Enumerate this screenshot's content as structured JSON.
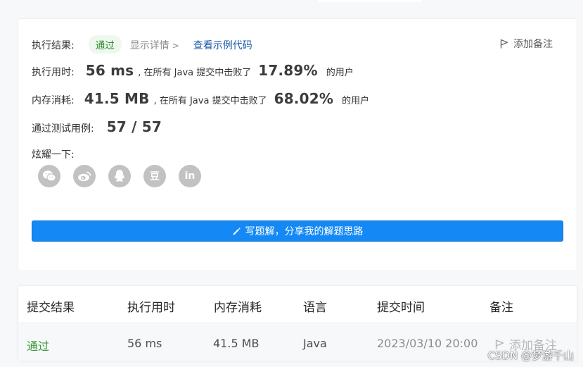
{
  "result": {
    "label": "执行结果:",
    "status": "通过",
    "detail_link": "显示详情",
    "detail_chevron": ">",
    "example_link": "查看示例代码",
    "add_note": "添加备注"
  },
  "runtime": {
    "label": "执行用时:",
    "value": "56 ms",
    "mid": ", 在所有 Java 提交中击败了",
    "percent": "17.89%",
    "tail": "的用户"
  },
  "memory": {
    "label": "内存消耗:",
    "value": "41.5 MB",
    "mid": ", 在所有 Java 提交中击败了",
    "percent": "68.02%",
    "tail": "的用户"
  },
  "tests": {
    "label": "通过测试用例:",
    "value": "57 / 57"
  },
  "share": {
    "label": "炫耀一下:",
    "icons": [
      "wechat-icon",
      "weibo-icon",
      "qq-icon",
      "douban-icon",
      "linkedin-icon"
    ],
    "douban_glyph": "豆",
    "linkedin_glyph": "in"
  },
  "write_button": {
    "label": "写题解，分享我的解题思路",
    "icon": "pencil-icon"
  },
  "table": {
    "headers": [
      "提交结果",
      "执行用时",
      "内存消耗",
      "语言",
      "提交时间",
      "备注"
    ],
    "row": {
      "result": "通过",
      "runtime": "56 ms",
      "memory": "41.5 MB",
      "language": "Java",
      "submitted_at": "2023/03/10 20:00",
      "note": "添加备注"
    }
  },
  "watermark": "CSDN @梦游千山",
  "colors": {
    "accent": "#1489f5",
    "pass_green": "#3a9a3a",
    "link_blue": "#1a5aa6",
    "icon_gray": "#c2c2c2"
  }
}
